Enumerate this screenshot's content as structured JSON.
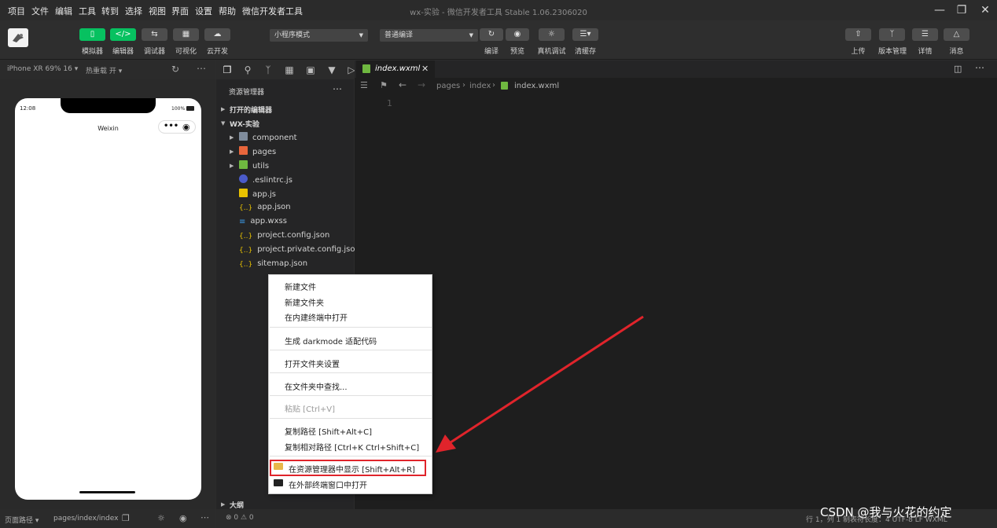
{
  "menu": [
    "项目",
    "文件",
    "编辑",
    "工具",
    "转到",
    "选择",
    "视图",
    "界面",
    "设置",
    "帮助",
    "微信开发者工具"
  ],
  "window_title": "wx-实验 - 微信开发者工具 Stable 1.06.2306020",
  "toolbar": {
    "left_buttons": [
      "模拟器",
      "编辑器",
      "调试器",
      "可视化",
      "云开发"
    ],
    "mode_select": "小程序模式",
    "compile_select": "普通编译",
    "center_buttons": [
      "编译",
      "预览",
      "真机调试",
      "清缓存"
    ],
    "right_buttons": [
      "上传",
      "版本管理",
      "详情",
      "消息"
    ]
  },
  "simulator": {
    "device": "iPhone XR 69% 16 ▾",
    "hot_reload": "热重载 开 ▾",
    "status_time": "12:08",
    "battery": "100%",
    "nav_title": "Weixin"
  },
  "sim_status": {
    "path_label": "页面路径 ▾",
    "path": "pages/index/index"
  },
  "explorer": {
    "title": "资源管理器",
    "open_editors": "打开的编辑器",
    "project": "WX-实验",
    "items": [
      {
        "name": "component",
        "type": "folder"
      },
      {
        "name": "pages",
        "type": "folder"
      },
      {
        "name": "utils",
        "type": "folder"
      },
      {
        "name": ".eslintrc.js",
        "type": "eslint"
      },
      {
        "name": "app.js",
        "type": "js"
      },
      {
        "name": "app.json",
        "type": "json"
      },
      {
        "name": "app.wxss",
        "type": "wxss"
      },
      {
        "name": "project.config.json",
        "type": "json"
      },
      {
        "name": "project.private.config.json",
        "type": "json"
      },
      {
        "name": "sitemap.json",
        "type": "json"
      }
    ],
    "outline": "大纲"
  },
  "editor": {
    "tab": "index.wxml",
    "breadcrumb": [
      "pages",
      "index",
      "index.wxml"
    ],
    "line_number": "1"
  },
  "context_menu": {
    "items": [
      {
        "label": "新建文件",
        "disabled": false
      },
      {
        "label": "新建文件夹",
        "disabled": false
      },
      {
        "label": "在内建终端中打开",
        "disabled": false
      },
      {
        "label": "生成 darkmode 适配代码",
        "disabled": false
      },
      {
        "label": "打开文件夹设置",
        "disabled": false
      },
      {
        "label": "在文件夹中查找...",
        "disabled": false
      },
      {
        "label": "粘贴  [Ctrl+V]",
        "disabled": true
      },
      {
        "label": "复制路径  [Shift+Alt+C]",
        "disabled": false
      },
      {
        "label": "复制相对路径  [Ctrl+K Ctrl+Shift+C]",
        "disabled": false
      },
      {
        "label": "在资源管理器中显示  [Shift+Alt+R]",
        "disabled": false
      },
      {
        "label": "在外部终端窗口中打开",
        "disabled": false
      }
    ]
  },
  "status_bar": {
    "problems": "⊗ 0 ⚠ 0",
    "right": "行 1，列 1    制表符长度：4    UTF-8    LF    WXML"
  },
  "watermark": "CSDN @我与火花的约定",
  "colors": {
    "accent": "#07c160",
    "highlight_box": "#e0242b",
    "arrow": "#e0242b"
  }
}
